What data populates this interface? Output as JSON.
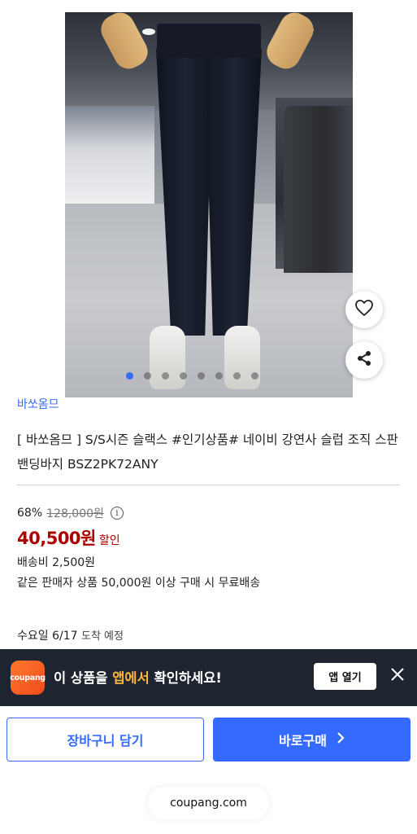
{
  "product": {
    "brand": "바쏘옴므",
    "title": "[ 바쏘옴므 ] S/S시즌 슬랙스 #인기상품# 네이비 강연사 슬럽 조직 스판 밴딩바지 BSZ2PK72ANY",
    "image_count": 8,
    "active_image_index": 0
  },
  "icons": {
    "wishlist": "heart-icon",
    "share": "share-icon",
    "info": "info-icon",
    "close": "close-icon",
    "chevron": "chevron-right-icon"
  },
  "pricing": {
    "discount_rate": "68%",
    "original_price": "128,000원",
    "info_glyph": "i",
    "sale_price": "40,500원",
    "sale_label": "할인"
  },
  "shipping": {
    "fee": "배송비 2,500원",
    "free_condition": "같은 판매자 상품 50,000원 이상 구매 시 무료배송",
    "arrival_day": "수요일 6/17",
    "arrival_suffix": "도착 예정"
  },
  "app_banner": {
    "logo_text": "coupang",
    "text_before": "이 상품을 ",
    "highlight": "앱에서",
    "text_after": " 확인하세요!",
    "open_button": "앱 열기"
  },
  "actions": {
    "cart": "장바구니 담기",
    "buy": "바로구매"
  },
  "footer": {
    "domain": "coupang.com"
  },
  "colors": {
    "accent": "#346aff",
    "price": "#ae0000",
    "banner_bg": "#1e2530",
    "banner_highlight": "#ffb43f"
  }
}
